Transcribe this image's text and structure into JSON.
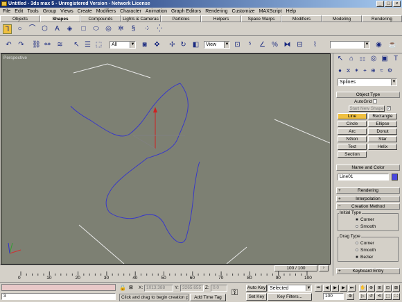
{
  "window": {
    "title": "Untitled - 3ds max 5 - Unregistered Version - Network License",
    "min": "_",
    "max": "□",
    "close": "×"
  },
  "menu": [
    "File",
    "Edit",
    "Tools",
    "Group",
    "Views",
    "Create",
    "Modifiers",
    "Character",
    "Animation",
    "Graph Editors",
    "Rendering",
    "Customize",
    "MAXScript",
    "Help"
  ],
  "tabs": [
    "Objects",
    "Shapes",
    "Compounds",
    "Lights & Cameras",
    "Particles",
    "Helpers",
    "Space Warps",
    "Modifiers",
    "Modeling",
    "Rendering"
  ],
  "active_tab": "Shapes",
  "toolbar": {
    "selection_filter": "All",
    "ref_coord": "View",
    "named_selection": ""
  },
  "viewport": {
    "label": "Perspective"
  },
  "timeline": {
    "frame_display": "100 / 100"
  },
  "ruler_ticks": [
    "0",
    "10",
    "20",
    "30",
    "40",
    "50",
    "60",
    "70",
    "80",
    "90",
    "100"
  ],
  "panel": {
    "category": "Splines",
    "object_type": {
      "header": "Object Type",
      "autogrid": "AutoGrid",
      "start_new_shape": "Start New Shape",
      "buttons": [
        [
          "Line",
          "Rectangle"
        ],
        [
          "Circle",
          "Ellipse"
        ],
        [
          "Arc",
          "Donut"
        ],
        [
          "NGon",
          "Star"
        ],
        [
          "Text",
          "Helix"
        ],
        [
          "Section",
          ""
        ]
      ],
      "active": "Line"
    },
    "name_color": {
      "header": "Name and Color",
      "name": "Line01",
      "color": "#4848e0"
    },
    "rendering": "Rendering",
    "interpolation": "Interpolation",
    "creation_method": {
      "header": "Creation Method",
      "initial_type": "Initial Type",
      "initial_options": [
        "Corner",
        "Smooth"
      ],
      "initial_selected": "Corner",
      "drag_type": "Drag Type",
      "drag_options": [
        "Corner",
        "Smooth",
        "Bezier"
      ],
      "drag_selected": "Bezier"
    },
    "keyboard_entry": "Keyboard Entry"
  },
  "status": {
    "maxscript_value": "3",
    "prompt": "Click and drag to begin creation pr",
    "add_time_tag": "Add Time Tag",
    "x_label": "X:",
    "x_value": "1013.388",
    "y_label": "Y:",
    "y_value": "3265.655",
    "z_label": "Z:",
    "z_value": "0.0",
    "auto_key": "Auto Key",
    "set_key": "Set Key",
    "key_mode": "Selected",
    "key_filters": "Key Filters...",
    "frame": "100"
  }
}
